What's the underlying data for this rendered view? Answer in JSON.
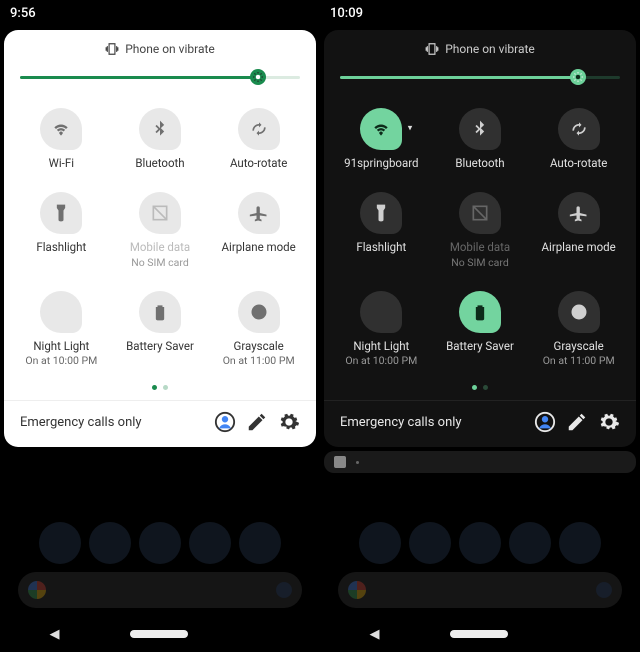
{
  "brightness_pct": 85,
  "left": {
    "time": "9:56",
    "vibrate_text": "Phone on vibrate",
    "tiles": [
      {
        "label": "Wi-Fi",
        "sub": "",
        "on": false,
        "disabled": false,
        "caret": false
      },
      {
        "label": "Bluetooth",
        "sub": "",
        "on": false,
        "disabled": false,
        "caret": false
      },
      {
        "label": "Auto-rotate",
        "sub": "",
        "on": false,
        "disabled": false,
        "caret": false
      },
      {
        "label": "Flashlight",
        "sub": "",
        "on": false,
        "disabled": false,
        "caret": false
      },
      {
        "label": "Mobile data",
        "sub": "No SIM card",
        "on": false,
        "disabled": true,
        "caret": false
      },
      {
        "label": "Airplane mode",
        "sub": "",
        "on": false,
        "disabled": false,
        "caret": false
      },
      {
        "label": "Night Light",
        "sub": "On at 10:00 PM",
        "on": false,
        "disabled": false,
        "caret": false
      },
      {
        "label": "Battery Saver",
        "sub": "",
        "on": false,
        "disabled": false,
        "caret": false
      },
      {
        "label": "Grayscale",
        "sub": "On at 11:00 PM",
        "on": false,
        "disabled": false,
        "caret": false
      }
    ],
    "footer_text": "Emergency calls only"
  },
  "right": {
    "time": "10:09",
    "vibrate_text": "Phone on vibrate",
    "tiles": [
      {
        "label": "91springboard",
        "sub": "",
        "on": true,
        "disabled": false,
        "caret": true
      },
      {
        "label": "Bluetooth",
        "sub": "",
        "on": false,
        "disabled": false,
        "caret": false
      },
      {
        "label": "Auto-rotate",
        "sub": "",
        "on": false,
        "disabled": false,
        "caret": false
      },
      {
        "label": "Flashlight",
        "sub": "",
        "on": false,
        "disabled": false,
        "caret": false
      },
      {
        "label": "Mobile data",
        "sub": "No SIM card",
        "on": false,
        "disabled": true,
        "caret": false
      },
      {
        "label": "Airplane mode",
        "sub": "",
        "on": false,
        "disabled": false,
        "caret": false
      },
      {
        "label": "Night Light",
        "sub": "On at 10:00 PM",
        "on": false,
        "disabled": false,
        "caret": false
      },
      {
        "label": "Battery Saver",
        "sub": "",
        "on": true,
        "disabled": false,
        "caret": false
      },
      {
        "label": "Grayscale",
        "sub": "On at 11:00 PM",
        "on": false,
        "disabled": false,
        "caret": false
      }
    ],
    "footer_text": "Emergency calls only"
  },
  "icon_map": [
    "wifi",
    "bluetooth",
    "rotate",
    "flashlight",
    "mobiledata",
    "airplane",
    "nightlight",
    "battery",
    "grayscale"
  ]
}
